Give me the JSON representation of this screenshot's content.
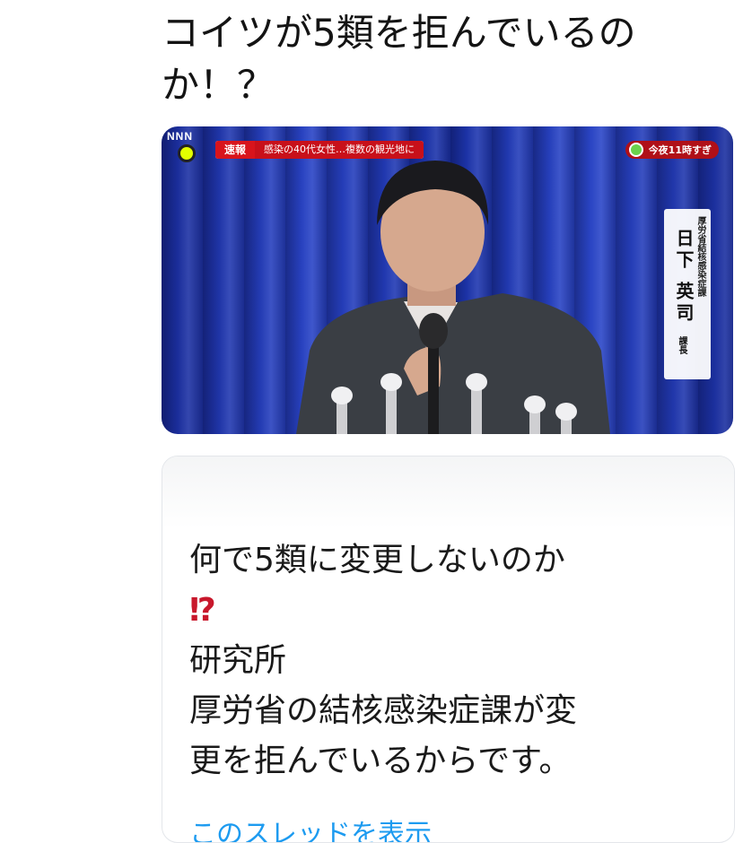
{
  "tweet": {
    "text": "コイツが5類を拒んでいるの\nか！？"
  },
  "media": {
    "network_logo": "NNN",
    "breaking_tag": "速報",
    "breaking_text": "感染の40代女性…複数の観光地に",
    "schedule_text": "今夜11時すぎ",
    "nameplate_department": "厚労省結核感染症課",
    "nameplate_name": "日下 英司",
    "nameplate_title": "課長"
  },
  "quoted": {
    "line1": "何で5類に変更しないのか",
    "exclaim": "⁉",
    "body": "研究所\n厚労省の結核感染症課が変\n更を拒んでいるからです。",
    "show_more": "このスレッドを表示"
  },
  "colors": {
    "curtain_blue": "#2a45c8",
    "breaking_red": "#d8141c",
    "exclaim_red": "#c8182c",
    "link_blue": "#1d9bf0"
  }
}
